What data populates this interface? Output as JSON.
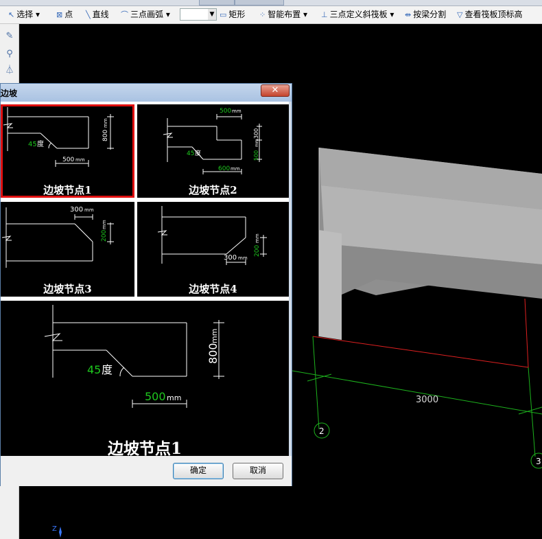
{
  "toolbar": {
    "items": [
      {
        "icon": "cursor-icon",
        "label": "选择"
      },
      {
        "icon": "point-icon",
        "label": "点"
      },
      {
        "icon": "line-icon",
        "label": "直线"
      },
      {
        "icon": "arc-icon",
        "label": "三点画弧"
      },
      {
        "icon": "rectangle-icon",
        "label": "矩形"
      },
      {
        "icon": "smart-layout-icon",
        "label": "智能布置"
      },
      {
        "icon": "sloped-slab-icon",
        "label": "三点定义斜筏板"
      },
      {
        "icon": "split-icon",
        "label": "按梁分割"
      },
      {
        "icon": "view-elevation-icon",
        "label": "查看筏板顶标高"
      }
    ]
  },
  "dialog": {
    "title": "筏板边坡",
    "close_label": "✕",
    "options": [
      {
        "caption": "边坡节点1",
        "selected": true
      },
      {
        "caption": "边坡节点2",
        "selected": false
      },
      {
        "caption": "边坡节点3",
        "selected": false
      },
      {
        "caption": "边坡节点4",
        "selected": false
      }
    ],
    "node1": {
      "angle": "45",
      "angle_unit": "度",
      "width": "500",
      "width_unit": "mm",
      "height": "800",
      "height_unit": "mm"
    },
    "node2": {
      "top": "500",
      "top_unit": "mm",
      "right_upper": "300",
      "right_lower": "500",
      "right_unit": "mm",
      "angle": "45",
      "angle_unit": "度",
      "bottom": "600",
      "bottom_unit": "mm"
    },
    "node3": {
      "top": "300",
      "top_unit": "mm",
      "right": "200",
      "right_unit": "mm"
    },
    "node4": {
      "bottom": "300",
      "bottom_unit": "mm",
      "right": "200",
      "right_unit": "mm"
    },
    "preview": {
      "caption": "边坡节点1",
      "angle": "45",
      "angle_unit": "度",
      "width": "500",
      "width_unit": "mm",
      "height": "800",
      "height_unit": "mm"
    },
    "ok_label": "确定",
    "cancel_label": "取消"
  },
  "scene": {
    "dimension": "3000",
    "axis_labels": [
      "2",
      "3"
    ],
    "coord_label": "Z"
  }
}
